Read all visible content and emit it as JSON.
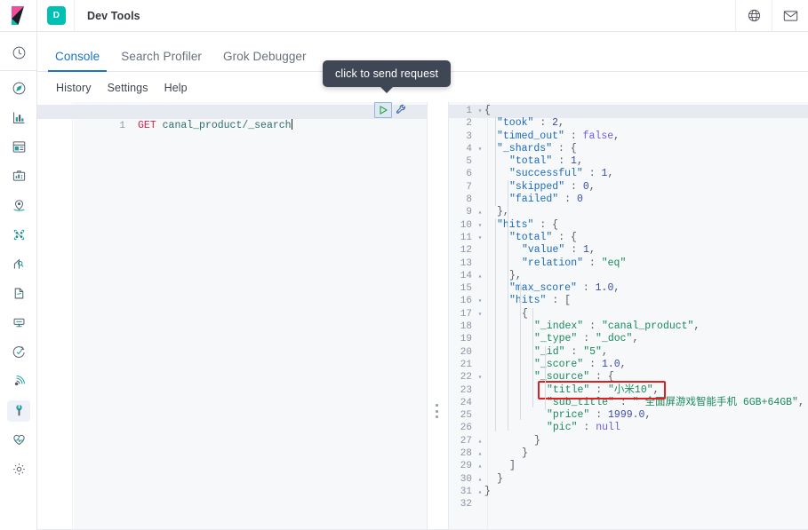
{
  "header": {
    "app_badge": "D",
    "app_title": "Dev Tools",
    "logo_icon": "kibana-logo",
    "right_icons": [
      {
        "name": "globe-help-icon",
        "glyph": "globe"
      },
      {
        "name": "mail-icon",
        "glyph": "envelope"
      }
    ],
    "logo_colors": {
      "pink": "#f04e98",
      "teal": "#00bfb3"
    },
    "badge_color": "#00bfb3"
  },
  "navrail": {
    "items": [
      {
        "name": "recently-viewed-icon",
        "glyph": "clock",
        "active": false
      },
      {
        "name": "discover-icon",
        "glyph": "compass",
        "active": false
      },
      {
        "name": "visualize-icon",
        "glyph": "bar-chart",
        "active": false
      },
      {
        "name": "dashboard-icon",
        "glyph": "dashboard",
        "active": false
      },
      {
        "name": "canvas-icon",
        "glyph": "presentation",
        "active": false
      },
      {
        "name": "maps-icon",
        "glyph": "map-pin",
        "active": false
      },
      {
        "name": "machine-learning-icon",
        "glyph": "ml-nodes",
        "active": false
      },
      {
        "name": "infrastructure-icon",
        "glyph": "infra",
        "active": false
      },
      {
        "name": "logs-icon",
        "glyph": "logs",
        "active": false
      },
      {
        "name": "apm-icon",
        "glyph": "apm",
        "active": false
      },
      {
        "name": "uptime-icon",
        "glyph": "uptime",
        "active": false
      },
      {
        "name": "siem-icon",
        "glyph": "siem",
        "active": false
      },
      {
        "name": "dev-tools-icon",
        "glyph": "wrench",
        "active": true
      },
      {
        "name": "monitoring-icon",
        "glyph": "heart-monitor",
        "active": false
      },
      {
        "name": "management-icon",
        "glyph": "gear",
        "active": false
      }
    ]
  },
  "tabs": [
    {
      "label": "Console",
      "active": true
    },
    {
      "label": "Search Profiler",
      "active": false
    },
    {
      "label": "Grok Debugger",
      "active": false
    }
  ],
  "submenu": [
    {
      "label": "History"
    },
    {
      "label": "Settings"
    },
    {
      "label": "Help"
    }
  ],
  "tooltip": {
    "text": "click to send request"
  },
  "editor": {
    "line_number": "1",
    "method": "GET",
    "path": " canal_product/_search",
    "play_button_name": "send-request-play-button",
    "wrench_button_name": "request-options-wrench-button"
  },
  "response": {
    "lines": [
      {
        "n": "1",
        "fold": "▾",
        "indent": 0,
        "tokens": [
          {
            "t": "{",
            "c": "pun"
          }
        ]
      },
      {
        "n": "2",
        "fold": "",
        "indent": 1,
        "tokens": [
          {
            "t": "\"took\"",
            "c": "k"
          },
          {
            "t": " : ",
            "c": "pun"
          },
          {
            "t": "2",
            "c": "num"
          },
          {
            "t": ",",
            "c": "pun"
          }
        ]
      },
      {
        "n": "3",
        "fold": "",
        "indent": 1,
        "tokens": [
          {
            "t": "\"timed_out\"",
            "c": "k"
          },
          {
            "t": " : ",
            "c": "pun"
          },
          {
            "t": "false",
            "c": "lit"
          },
          {
            "t": ",",
            "c": "pun"
          }
        ]
      },
      {
        "n": "4",
        "fold": "▾",
        "indent": 1,
        "tokens": [
          {
            "t": "\"_shards\"",
            "c": "k"
          },
          {
            "t": " : {",
            "c": "pun"
          }
        ]
      },
      {
        "n": "5",
        "fold": "",
        "indent": 2,
        "tokens": [
          {
            "t": "\"total\"",
            "c": "k"
          },
          {
            "t": " : ",
            "c": "pun"
          },
          {
            "t": "1",
            "c": "num"
          },
          {
            "t": ",",
            "c": "pun"
          }
        ]
      },
      {
        "n": "6",
        "fold": "",
        "indent": 2,
        "tokens": [
          {
            "t": "\"successful\"",
            "c": "k"
          },
          {
            "t": " : ",
            "c": "pun"
          },
          {
            "t": "1",
            "c": "num"
          },
          {
            "t": ",",
            "c": "pun"
          }
        ]
      },
      {
        "n": "7",
        "fold": "",
        "indent": 2,
        "tokens": [
          {
            "t": "\"skipped\"",
            "c": "k"
          },
          {
            "t": " : ",
            "c": "pun"
          },
          {
            "t": "0",
            "c": "num"
          },
          {
            "t": ",",
            "c": "pun"
          }
        ]
      },
      {
        "n": "8",
        "fold": "",
        "indent": 2,
        "tokens": [
          {
            "t": "\"failed\"",
            "c": "k"
          },
          {
            "t": " : ",
            "c": "pun"
          },
          {
            "t": "0",
            "c": "num"
          }
        ]
      },
      {
        "n": "9",
        "fold": "▴",
        "indent": 1,
        "tokens": [
          {
            "t": "},",
            "c": "pun"
          }
        ]
      },
      {
        "n": "10",
        "fold": "▾",
        "indent": 1,
        "tokens": [
          {
            "t": "\"hits\"",
            "c": "k"
          },
          {
            "t": " : {",
            "c": "pun"
          }
        ]
      },
      {
        "n": "11",
        "fold": "▾",
        "indent": 2,
        "tokens": [
          {
            "t": "\"total\"",
            "c": "k"
          },
          {
            "t": " : {",
            "c": "pun"
          }
        ]
      },
      {
        "n": "12",
        "fold": "",
        "indent": 3,
        "tokens": [
          {
            "t": "\"value\"",
            "c": "k"
          },
          {
            "t": " : ",
            "c": "pun"
          },
          {
            "t": "1",
            "c": "num"
          },
          {
            "t": ",",
            "c": "pun"
          }
        ]
      },
      {
        "n": "13",
        "fold": "",
        "indent": 3,
        "tokens": [
          {
            "t": "\"relation\"",
            "c": "k"
          },
          {
            "t": " : ",
            "c": "pun"
          },
          {
            "t": "\"eq\"",
            "c": "kg"
          }
        ]
      },
      {
        "n": "14",
        "fold": "▴",
        "indent": 2,
        "tokens": [
          {
            "t": "},",
            "c": "pun"
          }
        ]
      },
      {
        "n": "15",
        "fold": "",
        "indent": 2,
        "tokens": [
          {
            "t": "\"max_score\"",
            "c": "k"
          },
          {
            "t": " : ",
            "c": "pun"
          },
          {
            "t": "1.0",
            "c": "num"
          },
          {
            "t": ",",
            "c": "pun"
          }
        ]
      },
      {
        "n": "16",
        "fold": "▾",
        "indent": 2,
        "tokens": [
          {
            "t": "\"hits\"",
            "c": "k"
          },
          {
            "t": " : [",
            "c": "pun"
          }
        ]
      },
      {
        "n": "17",
        "fold": "▾",
        "indent": 3,
        "tokens": [
          {
            "t": "{",
            "c": "pun"
          }
        ]
      },
      {
        "n": "18",
        "fold": "",
        "indent": 4,
        "tokens": [
          {
            "t": "\"_index\"",
            "c": "kg"
          },
          {
            "t": " : ",
            "c": "pun"
          },
          {
            "t": "\"canal_product\"",
            "c": "kg"
          },
          {
            "t": ",",
            "c": "pun"
          }
        ]
      },
      {
        "n": "19",
        "fold": "",
        "indent": 4,
        "tokens": [
          {
            "t": "\"_type\"",
            "c": "kg"
          },
          {
            "t": " : ",
            "c": "pun"
          },
          {
            "t": "\"_doc\"",
            "c": "kg"
          },
          {
            "t": ",",
            "c": "pun"
          }
        ]
      },
      {
        "n": "20",
        "fold": "",
        "indent": 4,
        "tokens": [
          {
            "t": "\"_id\"",
            "c": "kg"
          },
          {
            "t": " : ",
            "c": "pun"
          },
          {
            "t": "\"5\"",
            "c": "kg"
          },
          {
            "t": ",",
            "c": "pun"
          }
        ]
      },
      {
        "n": "21",
        "fold": "",
        "indent": 4,
        "tokens": [
          {
            "t": "\"_score\"",
            "c": "kg"
          },
          {
            "t": " : ",
            "c": "pun"
          },
          {
            "t": "1.0",
            "c": "num"
          },
          {
            "t": ",",
            "c": "pun"
          }
        ]
      },
      {
        "n": "22",
        "fold": "▾",
        "indent": 4,
        "tokens": [
          {
            "t": "\"_source\"",
            "c": "kg"
          },
          {
            "t": " : {",
            "c": "pun"
          }
        ]
      },
      {
        "n": "23",
        "fold": "",
        "indent": 5,
        "tokens": [
          {
            "t": "\"title\"",
            "c": "kg"
          },
          {
            "t": " : ",
            "c": "pun"
          },
          {
            "t": "\"小米10\"",
            "c": "kg"
          },
          {
            "t": ",",
            "c": "pun"
          }
        ]
      },
      {
        "n": "24",
        "fold": "",
        "indent": 5,
        "tokens": [
          {
            "t": "\"sub_title\"",
            "c": "kg"
          },
          {
            "t": " : ",
            "c": "pun"
          },
          {
            "t": "\" 全面屏游戏智能手机 6GB+64GB\"",
            "c": "kg"
          },
          {
            "t": ",",
            "c": "pun"
          }
        ]
      },
      {
        "n": "25",
        "fold": "",
        "indent": 5,
        "tokens": [
          {
            "t": "\"price\"",
            "c": "kg"
          },
          {
            "t": " : ",
            "c": "pun"
          },
          {
            "t": "1999.0",
            "c": "num"
          },
          {
            "t": ",",
            "c": "pun"
          }
        ]
      },
      {
        "n": "26",
        "fold": "",
        "indent": 5,
        "tokens": [
          {
            "t": "\"pic\"",
            "c": "kg"
          },
          {
            "t": " : ",
            "c": "pun"
          },
          {
            "t": "null",
            "c": "lit"
          }
        ]
      },
      {
        "n": "27",
        "fold": "▴",
        "indent": 4,
        "tokens": [
          {
            "t": "}",
            "c": "pun"
          }
        ]
      },
      {
        "n": "28",
        "fold": "▴",
        "indent": 3,
        "tokens": [
          {
            "t": "}",
            "c": "pun"
          }
        ]
      },
      {
        "n": "29",
        "fold": "▴",
        "indent": 2,
        "tokens": [
          {
            "t": "]",
            "c": "pun"
          }
        ]
      },
      {
        "n": "30",
        "fold": "▴",
        "indent": 1,
        "tokens": [
          {
            "t": "}",
            "c": "pun"
          }
        ]
      },
      {
        "n": "31",
        "fold": "▴",
        "indent": 0,
        "tokens": [
          {
            "t": "}",
            "c": "pun"
          }
        ]
      },
      {
        "n": "32",
        "fold": "",
        "indent": 0,
        "tokens": []
      }
    ],
    "highlight": {
      "name": "title-field-highlight",
      "color": "#e02020",
      "line": "23"
    }
  }
}
